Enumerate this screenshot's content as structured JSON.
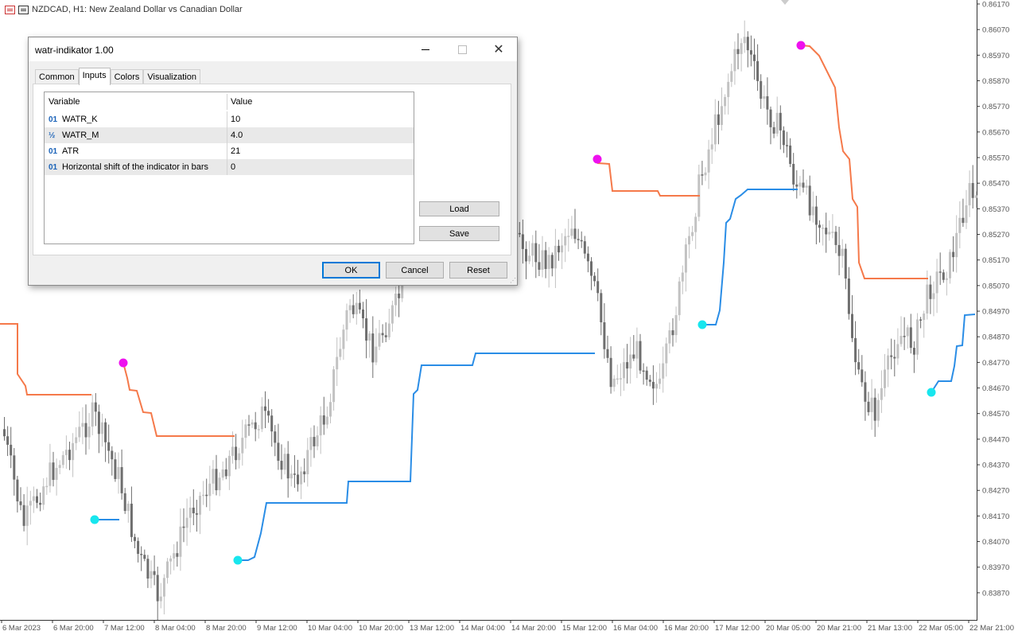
{
  "chart": {
    "symbol_title": "NZDCAD, H1:  New Zealand Dollar vs Canadian Dollar",
    "price_ticks": [
      "0.86170",
      "0.86070",
      "0.85970",
      "0.85870",
      "0.85770",
      "0.85670",
      "0.85570",
      "0.85470",
      "0.85370",
      "0.85270",
      "0.85170",
      "0.85070",
      "0.84970",
      "0.84870",
      "0.84770",
      "0.84670",
      "0.84570",
      "0.84470",
      "0.84370",
      "0.84270",
      "0.84170",
      "0.84070",
      "0.83970",
      "0.83870"
    ],
    "time_ticks": [
      "6 Mar 2023",
      "6 Mar 20:00",
      "7 Mar 12:00",
      "8 Mar 04:00",
      "8 Mar 20:00",
      "9 Mar 12:00",
      "10 Mar 04:00",
      "10 Mar 20:00",
      "13 Mar 12:00",
      "14 Mar 04:00",
      "14 Mar 20:00",
      "15 Mar 12:00",
      "16 Mar 04:00",
      "16 Mar 20:00",
      "17 Mar 12:00",
      "20 Mar 05:00",
      "20 Mar 21:00",
      "21 Mar 13:00",
      "22 Mar 05:00",
      "22 Mar 21:00"
    ],
    "colors": {
      "candle_bull": "#c2c2c2",
      "candle_bear": "#6e6e6e",
      "stop_down": "#f5794a",
      "stop_up": "#2a8de6",
      "signal_sell": "#ee11ee",
      "signal_buy": "#18e6ee"
    }
  },
  "dialog": {
    "title": "watr-indikator 1.00",
    "tabs": [
      "Common",
      "Inputs",
      "Colors",
      "Visualization"
    ],
    "active_tab": "Inputs",
    "columns": [
      "Variable",
      "Value"
    ],
    "params": [
      {
        "icon": "01",
        "name": "WATR_K",
        "value": "10"
      },
      {
        "icon": "½",
        "name": "WATR_M",
        "value": "4.0"
      },
      {
        "icon": "01",
        "name": "ATR",
        "value": "21"
      },
      {
        "icon": "01",
        "name": "Horizontal shift of the indicator in bars",
        "value": "0"
      }
    ],
    "load_label": "Load",
    "save_label": "Save",
    "ok_label": "OK",
    "cancel_label": "Cancel",
    "reset_label": "Reset"
  }
}
